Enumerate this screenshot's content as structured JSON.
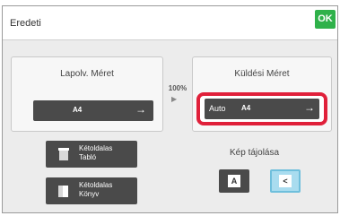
{
  "header": {
    "title": "Eredeti",
    "ok_label": "OK"
  },
  "left_panel": {
    "label": "Lapolv. Méret",
    "size_value": "A4",
    "arrow": "→"
  },
  "ratio": {
    "percent": "100%",
    "arrow": "▶"
  },
  "right_panel": {
    "label": "Küldési Méret",
    "mode": "Auto",
    "size_value": "A4",
    "arrow": "→"
  },
  "doc_buttons": [
    {
      "line1": "Kétoldalas",
      "line2": "Tabló",
      "icon": "tablet-document-icon"
    },
    {
      "line1": "Kétoldalas",
      "line2": "Könyv",
      "icon": "book-document-icon"
    }
  ],
  "orientation": {
    "label": "Kép tájolása",
    "options": [
      {
        "glyph": "A",
        "icon": "portrait-orientation-icon",
        "selected": false
      },
      {
        "glyph": "<",
        "icon": "landscape-orientation-icon",
        "selected": true
      }
    ]
  },
  "colors": {
    "ok": "#2fb14a",
    "highlight": "#e0203a",
    "selected": "#a9dcef",
    "button": "#4a4a4a"
  }
}
